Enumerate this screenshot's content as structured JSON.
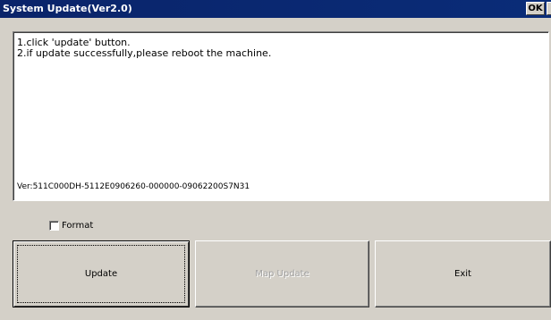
{
  "window": {
    "title": "System Update(Ver2.0)",
    "ok_label": "OK",
    "close_label": "×"
  },
  "instructions": {
    "line1": "1.click 'update' button.",
    "line2": "2.if update successfully,please reboot the machine.",
    "version": "Ver:511C000DH-5112E0906260-000000-09062200S7N31"
  },
  "options": {
    "format_label": "Format",
    "format_checked": false
  },
  "buttons": {
    "update": "Update",
    "map_update": "Map Update",
    "exit": "Exit"
  }
}
